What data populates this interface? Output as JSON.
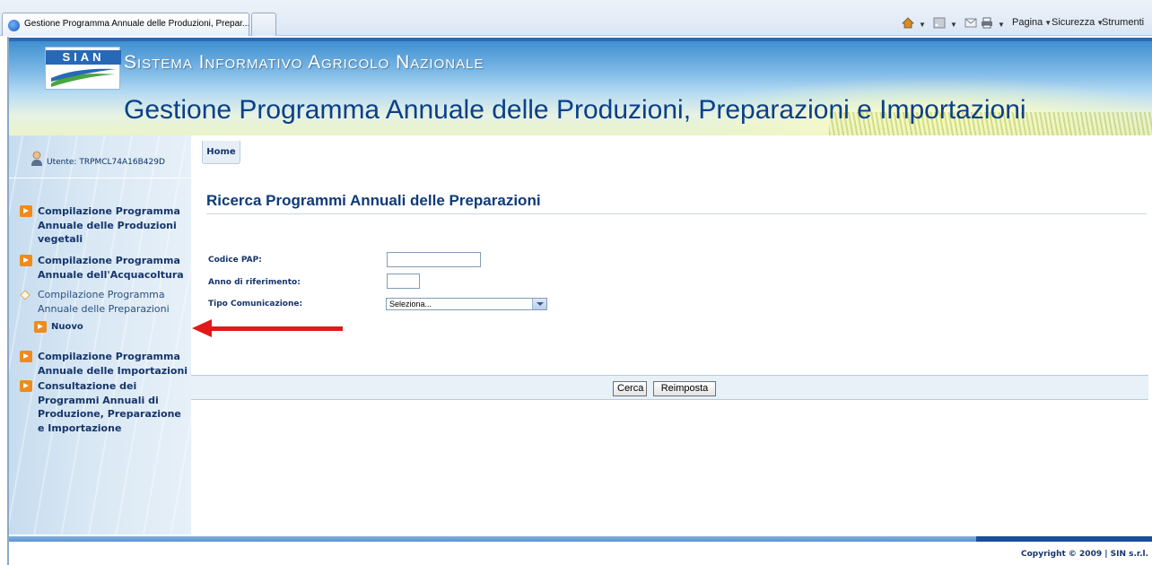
{
  "browser": {
    "tab_title": "Gestione Programma Annuale delle Produzioni, Prepar...",
    "commands": [
      "Pagina",
      "Sicurezza",
      "Strumenti"
    ]
  },
  "banner": {
    "logo_text": "SIAN",
    "system_name": "Sistema Informativo Agricolo Nazionale",
    "app_title": "Gestione Programma Annuale delle Produzioni, Preparazioni e Importazioni"
  },
  "sidebar": {
    "user_label": "Utente: TRPMCL74A16B429D",
    "items": [
      {
        "label": "Compilazione Programma Annuale delle Produzioni vegetali"
      },
      {
        "label": "Compilazione Programma Annuale dell'Acquacoltura"
      },
      {
        "label": "Compilazione Programma Annuale delle Preparazioni"
      },
      {
        "label": "Compilazione Programma Annuale delle Importazioni"
      },
      {
        "label": "Consultazione dei Programmi Annuali di Produzione, Preparazione e Importazione"
      }
    ],
    "sub_item": "Nuovo"
  },
  "nav": {
    "home": "Home"
  },
  "main": {
    "title": "Ricerca Programmi Annuali delle Preparazioni",
    "fields": {
      "codice_pap_label": "Codice PAP:",
      "codice_pap_value": "",
      "anno_label": "Anno di riferimento:",
      "anno_value": "",
      "tipo_label": "Tipo Comunicazione:",
      "tipo_selected": "Seleziona..."
    },
    "buttons": {
      "search": "Cerca",
      "reset": "Reimposta"
    }
  },
  "footer": {
    "copyright": "Copyright © 2009 | SIN s.r.l."
  },
  "colors": {
    "brand_blue": "#0a3f8a",
    "nav_text": "#16356b",
    "bullet_orange": "#ef8a1c",
    "annotation_red": "#e11919"
  }
}
